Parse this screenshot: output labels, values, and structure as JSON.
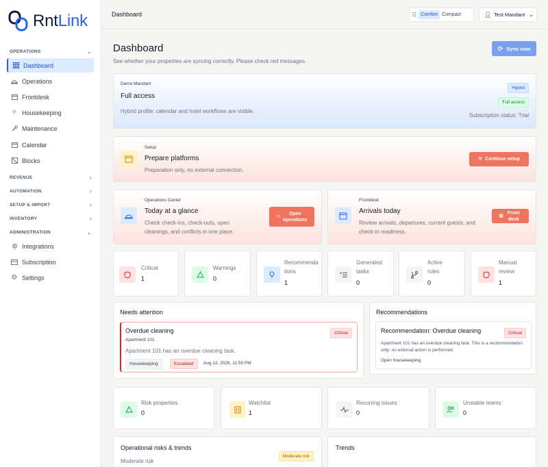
{
  "brand": {
    "part1": "Rnt",
    "part2": "Link"
  },
  "sidebar": {
    "operations_section": "OPERATIONS",
    "items": [
      {
        "label": "Dashboard"
      },
      {
        "label": "Operations"
      },
      {
        "label": "Frontdesk"
      },
      {
        "label": "Housekeeping"
      },
      {
        "label": "Maintenance"
      },
      {
        "label": "Calendar"
      },
      {
        "label": "Blocks"
      }
    ],
    "sections": [
      "REVENUE",
      "AUTOMATION",
      "SETUP & IMPORT",
      "INVENTORY",
      "ADMINISTRATION"
    ],
    "admin_items": [
      {
        "label": "Integrations"
      },
      {
        "label": "Subscription"
      },
      {
        "label": "Settings"
      }
    ]
  },
  "topbar": {
    "breadcrumb": "Dashboard",
    "density": {
      "comfort": "Comfort",
      "compact": "Compact",
      "selected": "Comfort"
    },
    "user": "Test Mandant"
  },
  "page": {
    "title": "Dashboard",
    "subtitle": "See whether your properties are syncing correctly. Please check red messages.",
    "sync_label": "Sync now"
  },
  "access": {
    "mandant": "Demo Mandant",
    "title": "Full access",
    "desc": "Hybrid profile: calendar and hotel workflows are visible.",
    "badge_hybrid": "Hybrid",
    "badge_full": "Full access",
    "subscription": "Subscription status: Trial"
  },
  "setup": {
    "kicker": "Setup",
    "title": "Prepare platforms",
    "desc": "Preparation only, no external connection.",
    "button": "Continue setup"
  },
  "ops_center": {
    "kicker": "Operations Center",
    "title": "Today at a glance",
    "desc": "Check check-ins, check-outs, open cleanings, and conflicts in one place.",
    "button": "Open operations"
  },
  "frontdesk": {
    "kicker": "Frontdesk",
    "title": "Arrivals today",
    "desc": "Review arrivals, departures, current guests, and check-in readiness.",
    "button": "Front desk"
  },
  "stats": [
    {
      "label": "Critical",
      "value": "1",
      "icon": "shield-icon"
    },
    {
      "label": "Warnings",
      "value": "0",
      "icon": "warning-icon"
    },
    {
      "label": "Recommendations",
      "value": "1",
      "icon": "bulb-icon"
    },
    {
      "label": "Generated tasks",
      "value": "0",
      "icon": "checklist-icon"
    },
    {
      "label": "Active rules",
      "value": "0",
      "icon": "branch-icon"
    },
    {
      "label": "Manual review",
      "value": "1",
      "icon": "shield-icon"
    }
  ],
  "attention": {
    "title": "Needs attention",
    "item": {
      "title": "Overdue cleaning",
      "property": "Apartment 101",
      "desc": "Apartment 101 has an overdue cleaning task.",
      "severity": "Critical",
      "tag_area": "Housekeeping",
      "tag_status": "Escalated",
      "timestamp": "Aug 12, 2026, 11:59 PM"
    }
  },
  "recommendations": {
    "title": "Recommendations",
    "item": {
      "title": "Recommendation: Overdue cleaning",
      "severity": "Critical",
      "desc": "Apartment 101 has an overdue cleaning task. This is a recommendation only; no external action is performed.",
      "link": "Open housekeeping"
    }
  },
  "risk_stats": [
    {
      "label": "Risk properties",
      "value": "0",
      "icon": "warning-icon"
    },
    {
      "label": "Watchlist",
      "value": "1",
      "icon": "building-icon"
    },
    {
      "label": "Recurring issues",
      "value": "0",
      "icon": "pulse-icon"
    },
    {
      "label": "Unstable teams",
      "value": "0",
      "icon": "users-icon"
    }
  ],
  "risks": {
    "title": "Operational risks & trends",
    "level": "Moderate risk",
    "badge": "Moderate risk"
  },
  "trends": {
    "title": "Trends"
  },
  "colors": {
    "accent": "#2563eb",
    "critical": "#dc2626",
    "action": "#f0735e"
  }
}
